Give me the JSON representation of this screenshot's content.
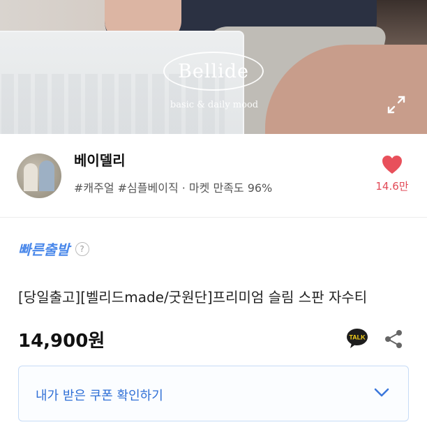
{
  "hero": {
    "brand_name": "Bellide",
    "brand_tagline": "basic & daily mood",
    "expand_icon": "expand-icon"
  },
  "seller": {
    "name": "베이델리",
    "tags": "#캐주얼 #심플베이직 · 마켓 만족도 96%",
    "likes": "14.6만",
    "heart_color": "#e8505b",
    "avatar_icon": "seller-avatar"
  },
  "badge": {
    "fast_shipping": "빠른출발",
    "help_symbol": "?"
  },
  "product": {
    "title": "[당일출고][벨리드made/굿원단]프리미엄 슬림 스판 자수티",
    "price": "14,900원"
  },
  "actions": {
    "talk_label": "TALK",
    "talk_icon": "kakao-talk-icon",
    "share_icon": "share-icon"
  },
  "coupon": {
    "label": "내가 받은 쿠폰 확인하기",
    "chevron_icon": "chevron-down-icon",
    "accent": "#2f6fd6"
  }
}
